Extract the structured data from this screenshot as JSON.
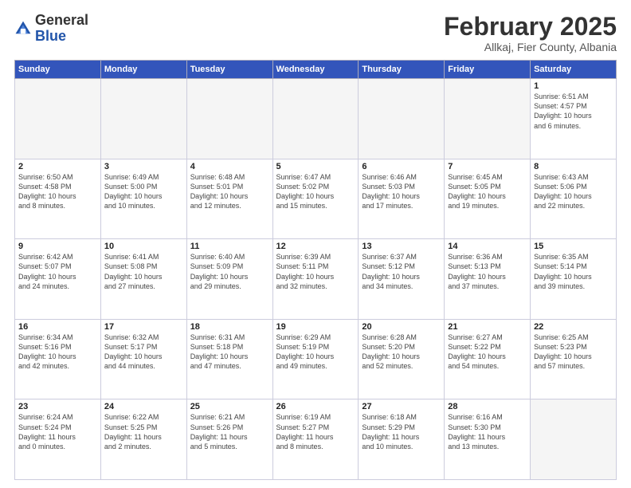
{
  "header": {
    "logo_general": "General",
    "logo_blue": "Blue",
    "title": "February 2025",
    "subtitle": "Allkaj, Fier County, Albania"
  },
  "weekdays": [
    "Sunday",
    "Monday",
    "Tuesday",
    "Wednesday",
    "Thursday",
    "Friday",
    "Saturday"
  ],
  "weeks": [
    [
      {
        "day": "",
        "info": ""
      },
      {
        "day": "",
        "info": ""
      },
      {
        "day": "",
        "info": ""
      },
      {
        "day": "",
        "info": ""
      },
      {
        "day": "",
        "info": ""
      },
      {
        "day": "",
        "info": ""
      },
      {
        "day": "1",
        "info": "Sunrise: 6:51 AM\nSunset: 4:57 PM\nDaylight: 10 hours\nand 6 minutes."
      }
    ],
    [
      {
        "day": "2",
        "info": "Sunrise: 6:50 AM\nSunset: 4:58 PM\nDaylight: 10 hours\nand 8 minutes."
      },
      {
        "day": "3",
        "info": "Sunrise: 6:49 AM\nSunset: 5:00 PM\nDaylight: 10 hours\nand 10 minutes."
      },
      {
        "day": "4",
        "info": "Sunrise: 6:48 AM\nSunset: 5:01 PM\nDaylight: 10 hours\nand 12 minutes."
      },
      {
        "day": "5",
        "info": "Sunrise: 6:47 AM\nSunset: 5:02 PM\nDaylight: 10 hours\nand 15 minutes."
      },
      {
        "day": "6",
        "info": "Sunrise: 6:46 AM\nSunset: 5:03 PM\nDaylight: 10 hours\nand 17 minutes."
      },
      {
        "day": "7",
        "info": "Sunrise: 6:45 AM\nSunset: 5:05 PM\nDaylight: 10 hours\nand 19 minutes."
      },
      {
        "day": "8",
        "info": "Sunrise: 6:43 AM\nSunset: 5:06 PM\nDaylight: 10 hours\nand 22 minutes."
      }
    ],
    [
      {
        "day": "9",
        "info": "Sunrise: 6:42 AM\nSunset: 5:07 PM\nDaylight: 10 hours\nand 24 minutes."
      },
      {
        "day": "10",
        "info": "Sunrise: 6:41 AM\nSunset: 5:08 PM\nDaylight: 10 hours\nand 27 minutes."
      },
      {
        "day": "11",
        "info": "Sunrise: 6:40 AM\nSunset: 5:09 PM\nDaylight: 10 hours\nand 29 minutes."
      },
      {
        "day": "12",
        "info": "Sunrise: 6:39 AM\nSunset: 5:11 PM\nDaylight: 10 hours\nand 32 minutes."
      },
      {
        "day": "13",
        "info": "Sunrise: 6:37 AM\nSunset: 5:12 PM\nDaylight: 10 hours\nand 34 minutes."
      },
      {
        "day": "14",
        "info": "Sunrise: 6:36 AM\nSunset: 5:13 PM\nDaylight: 10 hours\nand 37 minutes."
      },
      {
        "day": "15",
        "info": "Sunrise: 6:35 AM\nSunset: 5:14 PM\nDaylight: 10 hours\nand 39 minutes."
      }
    ],
    [
      {
        "day": "16",
        "info": "Sunrise: 6:34 AM\nSunset: 5:16 PM\nDaylight: 10 hours\nand 42 minutes."
      },
      {
        "day": "17",
        "info": "Sunrise: 6:32 AM\nSunset: 5:17 PM\nDaylight: 10 hours\nand 44 minutes."
      },
      {
        "day": "18",
        "info": "Sunrise: 6:31 AM\nSunset: 5:18 PM\nDaylight: 10 hours\nand 47 minutes."
      },
      {
        "day": "19",
        "info": "Sunrise: 6:29 AM\nSunset: 5:19 PM\nDaylight: 10 hours\nand 49 minutes."
      },
      {
        "day": "20",
        "info": "Sunrise: 6:28 AM\nSunset: 5:20 PM\nDaylight: 10 hours\nand 52 minutes."
      },
      {
        "day": "21",
        "info": "Sunrise: 6:27 AM\nSunset: 5:22 PM\nDaylight: 10 hours\nand 54 minutes."
      },
      {
        "day": "22",
        "info": "Sunrise: 6:25 AM\nSunset: 5:23 PM\nDaylight: 10 hours\nand 57 minutes."
      }
    ],
    [
      {
        "day": "23",
        "info": "Sunrise: 6:24 AM\nSunset: 5:24 PM\nDaylight: 11 hours\nand 0 minutes."
      },
      {
        "day": "24",
        "info": "Sunrise: 6:22 AM\nSunset: 5:25 PM\nDaylight: 11 hours\nand 2 minutes."
      },
      {
        "day": "25",
        "info": "Sunrise: 6:21 AM\nSunset: 5:26 PM\nDaylight: 11 hours\nand 5 minutes."
      },
      {
        "day": "26",
        "info": "Sunrise: 6:19 AM\nSunset: 5:27 PM\nDaylight: 11 hours\nand 8 minutes."
      },
      {
        "day": "27",
        "info": "Sunrise: 6:18 AM\nSunset: 5:29 PM\nDaylight: 11 hours\nand 10 minutes."
      },
      {
        "day": "28",
        "info": "Sunrise: 6:16 AM\nSunset: 5:30 PM\nDaylight: 11 hours\nand 13 minutes."
      },
      {
        "day": "",
        "info": ""
      }
    ]
  ]
}
